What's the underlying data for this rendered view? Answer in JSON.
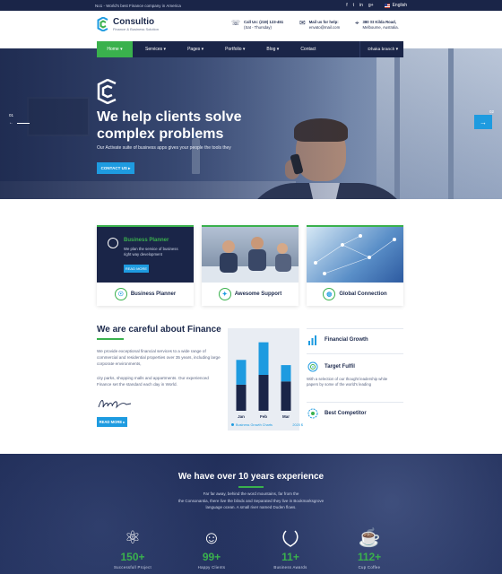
{
  "topbar": {
    "tagline": "No1 - World's best Finance company in America",
    "socials": [
      "f",
      "t",
      "in",
      "g+"
    ],
    "language": "English"
  },
  "header": {
    "brand": "Consultio",
    "brand_sub": "Finance & Business Solution",
    "call_label": "Call Us: (219) 123-451",
    "call_hours": "(Sat - Thursday)",
    "mail_label": "Mail us for help:",
    "mail_value": "envato@mail.com",
    "address_line1": "380 St Kilda Road,",
    "address_line2": "Melbourne, Australia."
  },
  "nav": {
    "items": [
      "Home ▾",
      "Services ▾",
      "Pages ▾",
      "Portfolio ▾",
      "Blog ▾",
      "Contact"
    ],
    "branch": "Dhaka branch ▾"
  },
  "hero": {
    "title_line1": "We help clients solve",
    "title_line2": "complex problems",
    "subtitle": "Our Activate suite of business apps gives your people the tools they",
    "button": "CONTACT US ▸",
    "slide_prev": "01",
    "slide_next": "02"
  },
  "cards": [
    {
      "label": "Business Planner",
      "overlay_title": "Business Planner",
      "overlay_text": "We plan the service of business right way development",
      "overlay_button": "READ MORE"
    },
    {
      "label": "Awesome Support"
    },
    {
      "label": "Global Connection"
    }
  ],
  "about": {
    "title": "We are careful about Finance",
    "p1": "We provide exceptional financial services to a wide range of commercial and residential properties over 35 years, including large corporate environments,",
    "p2": "city parks, shopping malls and appartments. Our experienced Finance set the standard each day in World.",
    "button": "READ MORE ▸"
  },
  "chart_data": {
    "type": "bar",
    "categories": [
      "Jan",
      "Feb",
      "Mar"
    ],
    "series": [
      {
        "values": [
          40,
          55,
          45
        ],
        "color": "#1a2548"
      },
      {
        "values": [
          38,
          50,
          25
        ],
        "color": "#1e9be0"
      }
    ],
    "legend_label": "Business Growth Charts",
    "year_label": "2020 $",
    "ylim": [
      0,
      110
    ]
  },
  "features": [
    {
      "title": "Financial Growth",
      "icon": "bar-chart-icon",
      "text": ""
    },
    {
      "title": "Target Fulfil",
      "icon": "target-icon",
      "text": "With a selection of our thought leadership white papers by some of the world's leading"
    },
    {
      "title": "Best Competitor",
      "icon": "competitor-icon",
      "text": ""
    }
  ],
  "stats": {
    "title": "We have over 10 years experience",
    "text_line1": "Far far away, behind the word mountains, far from the",
    "text_line2": "the Consonantia, there live the blindx and Separated they live in Bookmarksgrove",
    "text_line3": "language ocean. A small river named Duden flows.",
    "items": [
      {
        "number": "150+",
        "label": "Successfull Project",
        "icon": "atom-icon"
      },
      {
        "number": "99+",
        "label": "Happy Clients",
        "icon": "smile-icon"
      },
      {
        "number": "11+",
        "label": "Business Awards",
        "icon": "laurel-icon"
      },
      {
        "number": "112+",
        "label": "Cup Coffee",
        "icon": "coffee-icon"
      }
    ]
  },
  "colors": {
    "navy": "#1a2548",
    "green": "#3ab14d",
    "blue": "#1e9be0"
  }
}
